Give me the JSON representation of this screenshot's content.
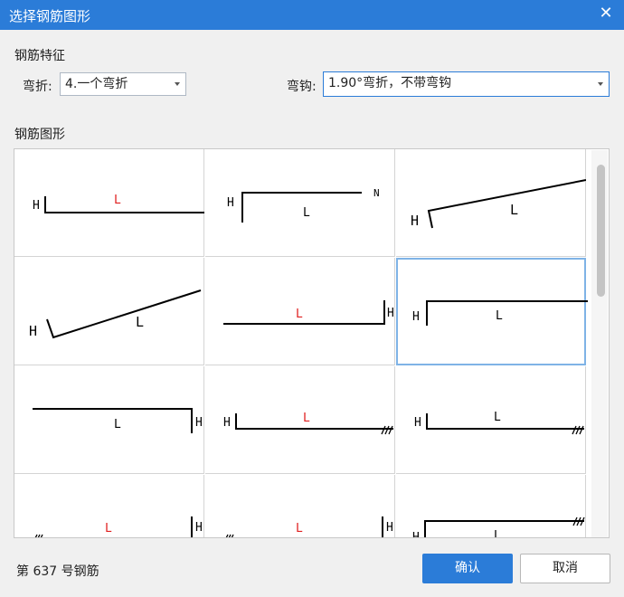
{
  "window": {
    "title": "选择钢筋图形",
    "close_glyph": "✕"
  },
  "features": {
    "section_title": "钢筋特征",
    "bend_label": "弯折:",
    "bend_value": "4.一个弯折",
    "hook_label": "弯钩:",
    "hook_value": "1.90°弯折，不带弯钩"
  },
  "shapes": {
    "section_title": "钢筋图形",
    "selected_index": 5,
    "cells": [
      {
        "labels": [
          "H",
          "L"
        ]
      },
      {
        "labels": [
          "H",
          "L",
          "N"
        ]
      },
      {
        "labels": [
          "H",
          "L"
        ]
      },
      {
        "labels": [
          "H",
          "L"
        ]
      },
      {
        "labels": [
          "L",
          "H"
        ]
      },
      {
        "labels": [
          "H",
          "L"
        ]
      },
      {
        "labels": [
          "L",
          "H"
        ]
      },
      {
        "labels": [
          "H",
          "L"
        ]
      },
      {
        "labels": [
          "H",
          "L"
        ]
      },
      {
        "labels": [
          "L",
          "H"
        ]
      },
      {
        "labels": [
          "L",
          "H"
        ]
      },
      {
        "labels": [
          "H",
          "L"
        ]
      }
    ]
  },
  "footer": {
    "status": "第 637 号钢筋",
    "ok_label": "确认",
    "cancel_label": "取消"
  },
  "colors": {
    "accent": "#2b7cd8",
    "label_red": "#e02020"
  }
}
